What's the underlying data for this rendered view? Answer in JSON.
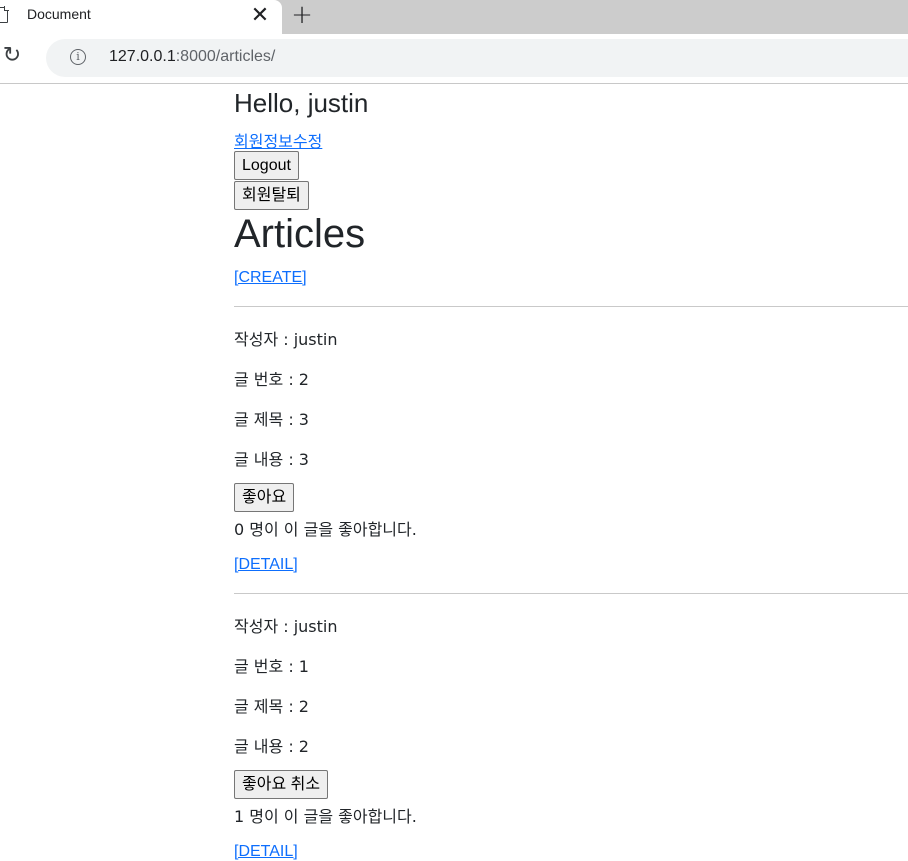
{
  "browser": {
    "tab_title": "Document",
    "close_glyph": "✕",
    "new_tab_glyph": "+",
    "reload_glyph": "↻",
    "info_glyph": "i",
    "url_host": "127.0.0.1",
    "url_rest": ":8000/articles/"
  },
  "header": {
    "greeting": "Hello, justin",
    "edit_profile_link": "회원정보수정",
    "logout_button": "Logout",
    "delete_account_button": "회원탈퇴"
  },
  "page": {
    "title": "Articles",
    "create_link": "[CREATE]"
  },
  "articles": [
    {
      "author": "작성자 : justin",
      "number": "글 번호 : 2",
      "title": "글 제목 : 3",
      "content": "글 내용 : 3",
      "like_button": "좋아요",
      "like_count": "0 명이 이 글을 좋아합니다.",
      "detail_link": "[DETAIL]"
    },
    {
      "author": "작성자 : justin",
      "number": "글 번호 : 1",
      "title": "글 제목 : 2",
      "content": "글 내용 : 2",
      "like_button": "좋아요 취소",
      "like_count": "1 명이 이 글을 좋아합니다.",
      "detail_link": "[DETAIL]"
    }
  ],
  "colors": {
    "link": "#0d6efd",
    "text": "#212529",
    "tabstrip": "#cccccc",
    "omnibox": "#f1f3f4"
  }
}
